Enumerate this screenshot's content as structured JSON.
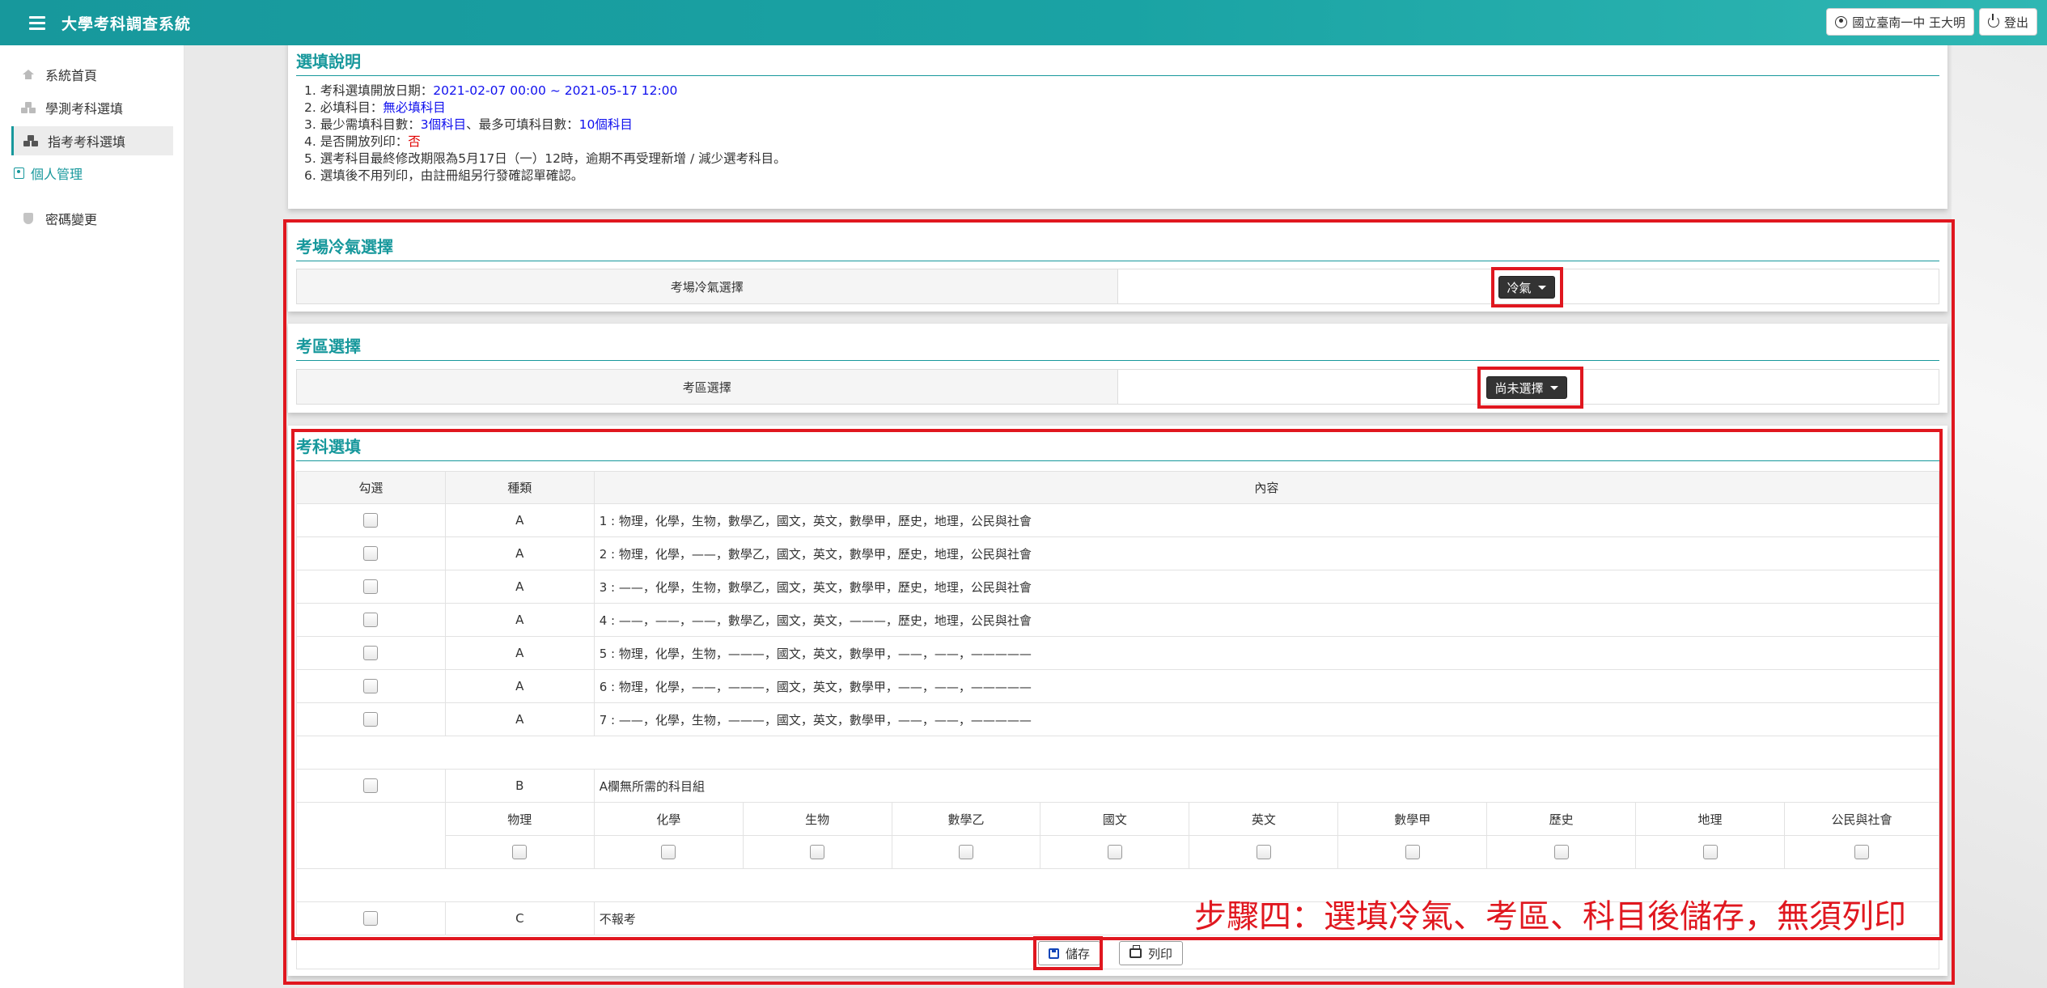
{
  "app": {
    "title": "大學考科調查系統",
    "user_label": "國立臺南一中 王大明",
    "logout_label": "登出"
  },
  "sidebar": {
    "items": [
      {
        "label": "系統首頁",
        "icon": "home-icon"
      },
      {
        "label": "學測考科選填",
        "icon": "cubes-icon"
      },
      {
        "label": "指考考科選填",
        "icon": "cubes-icon",
        "active": true
      },
      {
        "label": "個人管理",
        "icon": "user-square-icon"
      },
      {
        "label": "密碼變更",
        "icon": "shield-icon"
      }
    ]
  },
  "instructions": {
    "title": "選填說明",
    "line1_prefix": "1. 考科選填開放日期：",
    "line1_value": "2021-02-07 00:00 ~ 2021-05-17 12:00",
    "line2_prefix": "2. 必填科目：",
    "line2_value": "無必填科目",
    "line3_prefix": "3. 最少需填科目數：",
    "line3_min": "3個科目",
    "line3_mid": "、最多可填科目數：",
    "line3_max": "10個科目",
    "line4_prefix": "4. 是否開放列印：",
    "line4_value": "否",
    "line5": "5. 選考科目最終修改期限為5月17日（一）12時，逾期不再受理新增 / 減少選考科目。",
    "line6": "6. 選填後不用列印，由註冊組另行發確認單確認。"
  },
  "ac_section": {
    "title": "考場冷氣選擇",
    "label": "考場冷氣選擇",
    "selected": "冷氣"
  },
  "area_section": {
    "title": "考區選擇",
    "label": "考區選擇",
    "selected": "尚未選擇"
  },
  "subjects": {
    "title": "考科選填",
    "headers": {
      "check": "勾選",
      "type": "種類",
      "content": "內容"
    },
    "rows_a": [
      {
        "type": "A",
        "content": "1 : 物理，化學，生物，數學乙，國文，英文，數學甲，歷史，地理，公民與社會"
      },
      {
        "type": "A",
        "content": "2 : 物理，化學，——，數學乙，國文，英文，數學甲，歷史，地理，公民與社會"
      },
      {
        "type": "A",
        "content": "3 : ——，化學，生物，數學乙，國文，英文，數學甲，歷史，地理，公民與社會"
      },
      {
        "type": "A",
        "content": "4 : ——，——，——，數學乙，國文，英文，———，歷史，地理，公民與社會"
      },
      {
        "type": "A",
        "content": "5 : 物理，化學，生物，———，國文，英文，數學甲，——，——，—————"
      },
      {
        "type": "A",
        "content": "6 : 物理，化學，——，———，國文，英文，數學甲，——，——，—————"
      },
      {
        "type": "A",
        "content": "7 : ——，化學，生物，———，國文，英文，數學甲，——，——，—————"
      }
    ],
    "row_b": {
      "type": "B",
      "content": "A欄無所需的科目組"
    },
    "b_subjects": [
      "物理",
      "化學",
      "生物",
      "數學乙",
      "國文",
      "英文",
      "數學甲",
      "歷史",
      "地理",
      "公民與社會"
    ],
    "row_c": {
      "type": "C",
      "content": "不報考"
    }
  },
  "actions": {
    "save_label": "儲存",
    "print_label": "列印"
  },
  "annotation": "步驟四：選填冷氣、考區、科目後儲存，無須列印",
  "colors": {
    "brand": "#17989c",
    "highlight": "#e0171f",
    "link_blue": "#1010ee",
    "warning_red": "#e00000"
  }
}
